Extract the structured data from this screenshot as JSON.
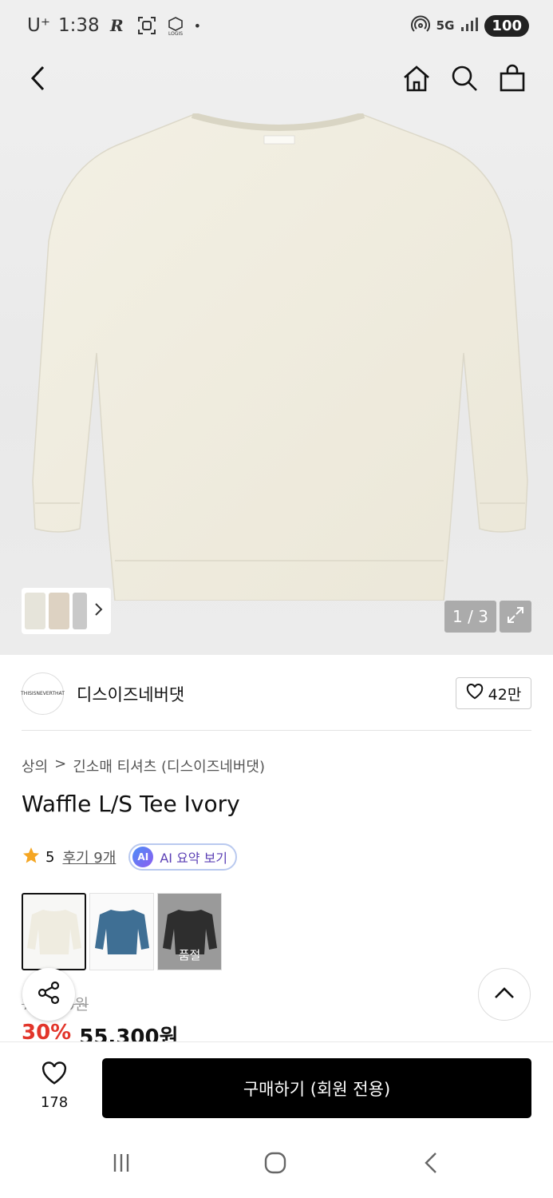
{
  "status_bar": {
    "carrier": "U⁺",
    "time": "1:38",
    "network": "5G",
    "battery": "100"
  },
  "hero": {
    "pager": "1 / 3"
  },
  "brand": {
    "logo_text": "THISISNEVERTHAT",
    "name": "디스이즈네버댓",
    "likes": "42만"
  },
  "breadcrumb": {
    "cat1": "상의",
    "sep": ">",
    "cat2": "긴소매 티셔츠 (디스이즈네버댓)"
  },
  "product": {
    "title": "Waffle L/S Tee Ivory",
    "rating": "5",
    "reviews": "후기 9개"
  },
  "ai": {
    "badge": "AI",
    "label": "AI 요약 보기"
  },
  "swatches": [
    {
      "name": "ivory",
      "color": "#efece0"
    },
    {
      "name": "blue",
      "color": "#3f6f94"
    },
    {
      "name": "black",
      "color": "#2e2e2e",
      "soldout": "품절"
    }
  ],
  "price": {
    "original": "79,000원",
    "discount": "30%",
    "sale": "55,300원"
  },
  "bottom": {
    "wish_count": "178",
    "buy_label": "구매하기 (회원 전용)"
  },
  "colors": {
    "accent_red": "#e2352a",
    "star": "#f5a623",
    "ai_purple": "#5b3fb5"
  }
}
